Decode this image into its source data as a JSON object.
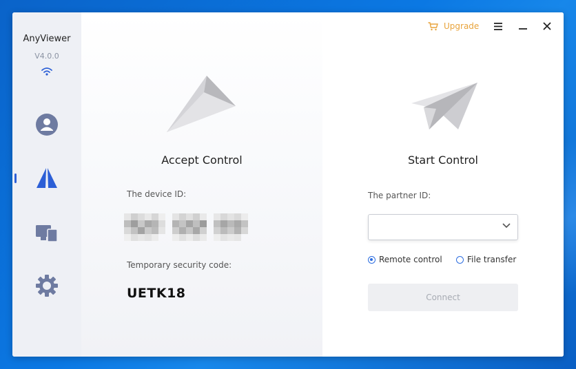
{
  "app": {
    "name": "AnyViewer",
    "version": "V4.0.0"
  },
  "topbar": {
    "upgrade_label": "Upgrade"
  },
  "sidebar": {
    "items": [
      {
        "name": "account",
        "icon": "user-icon"
      },
      {
        "name": "connect",
        "icon": "paper-plane-icon",
        "active": true
      },
      {
        "name": "devices",
        "icon": "devices-icon"
      },
      {
        "name": "settings",
        "icon": "gear-icon"
      }
    ]
  },
  "accept": {
    "title": "Accept Control",
    "device_id_label": "The device ID:",
    "security_code_label": "Temporary security code:",
    "security_code": "UETK18"
  },
  "start": {
    "title": "Start Control",
    "partner_id_label": "The partner ID:",
    "partner_id_value": "",
    "options": [
      {
        "label": "Remote control",
        "checked": true
      },
      {
        "label": "File transfer",
        "checked": false
      }
    ],
    "connect_label": "Connect"
  },
  "colors": {
    "accent": "#2c5fd6",
    "upgrade": "#e8a33b",
    "sidebar_bg": "#eef0f5"
  }
}
